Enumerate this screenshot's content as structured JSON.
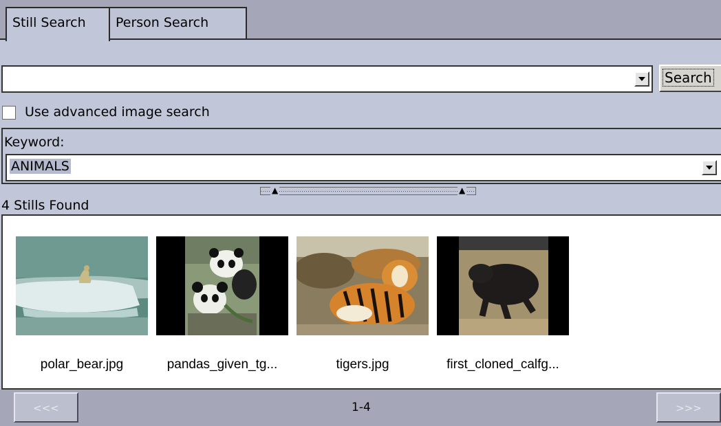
{
  "tabs": [
    {
      "label": "Still Search"
    },
    {
      "label": "Person Search"
    }
  ],
  "search": {
    "value": "",
    "button_label": "Search"
  },
  "advanced": {
    "label": "Use advanced image search",
    "checked": false
  },
  "keyword": {
    "label": "Keyword:",
    "value": "ANIMALS"
  },
  "results": {
    "count_label": "4 Stills Found",
    "items": [
      {
        "caption": "polar_bear.jpg"
      },
      {
        "caption": "pandas_given_tg..."
      },
      {
        "caption": "tigers.jpg"
      },
      {
        "caption": "first_cloned_calfg..."
      }
    ]
  },
  "pager": {
    "prev_label": "<<<",
    "range": "1-4",
    "next_label": ">>>"
  }
}
